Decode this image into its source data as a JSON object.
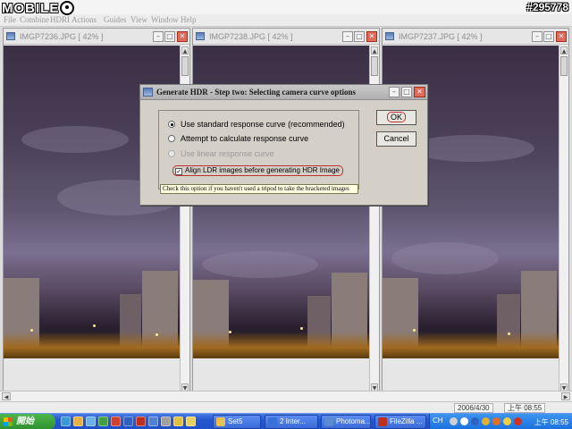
{
  "watermark": {
    "logo": "MOBILE",
    "post_id": "#295778"
  },
  "menubar": {
    "items": [
      "File",
      "Combine",
      "HDRI",
      "Actions",
      "Guides",
      "View",
      "Window",
      "Help"
    ]
  },
  "windows": [
    {
      "title": "IMGP7236.JPG [ 42% ]"
    },
    {
      "title": "IMGP7238.JPG [ 42% ]"
    },
    {
      "title": "IMGP7237.JPG [ 42% ]"
    }
  ],
  "dialog": {
    "title": "Generate HDR - Step two: Selecting camera curve options",
    "options": [
      {
        "label": "Use standard response curve  (recommended)",
        "selected": true,
        "enabled": true
      },
      {
        "label": "Attempt to calculate response curve",
        "selected": false,
        "enabled": true
      },
      {
        "label": "Use linear response curve",
        "selected": false,
        "enabled": false
      }
    ],
    "align_checkbox": {
      "label": "Align LDR images before generating HDR Image",
      "checked": true,
      "mark": "✓"
    },
    "hint": "Check this option if you haven't used a tripod to take the bracketed images",
    "ok_label": "OK",
    "cancel_label": "Cancel"
  },
  "statusbar": {
    "date": "2006/4/30",
    "time": "上午 08:55"
  },
  "taskbar": {
    "start_label": "開始",
    "tasks": [
      {
        "label": "Set5",
        "icon_color": "#e8c050"
      },
      {
        "label": "2 Inter...",
        "icon_color": "#3a70d8"
      },
      {
        "label": "Photoma...",
        "icon_color": "#5a8ad0"
      },
      {
        "label": "FileZilla ...",
        "icon_color": "#c03020"
      }
    ],
    "tray": {
      "lang": "CH",
      "clock": "上午 08:55"
    }
  },
  "colors": {
    "close_button": "#e06a5a",
    "taskbar": "#2556d0",
    "start": "#2e8e2e",
    "highlight": "#c03030"
  }
}
